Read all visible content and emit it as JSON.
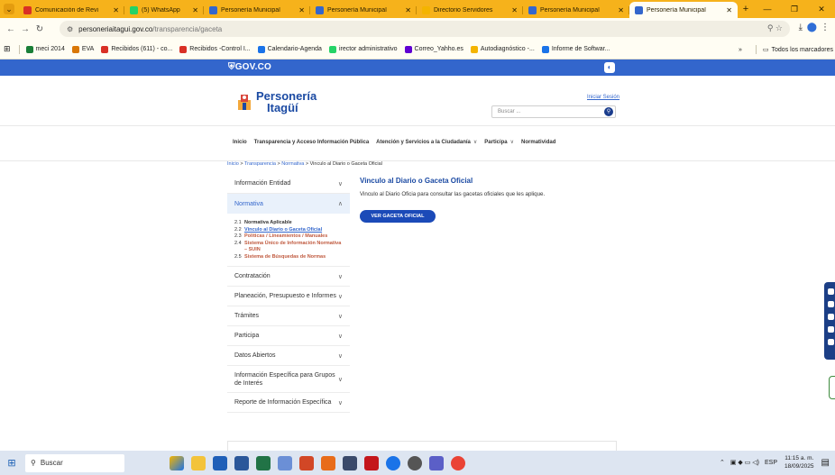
{
  "browser": {
    "tabs": [
      {
        "label": "Comunicación de Revi",
        "color": "#d93025",
        "active": false
      },
      {
        "label": "(5) WhatsApp",
        "color": "#25d366",
        "active": false
      },
      {
        "label": "Personería Municipal",
        "color": "#3366cc",
        "active": false
      },
      {
        "label": "Personería Municipal",
        "color": "#3366cc",
        "active": false
      },
      {
        "label": "Directorio Servidores",
        "color": "#f4b400",
        "active": false
      },
      {
        "label": "Personería Municipal",
        "color": "#3366cc",
        "active": false
      },
      {
        "label": "Personería Municipal",
        "color": "#3366cc",
        "active": true
      }
    ],
    "new_tab": "+",
    "url_domain": "personeriaitagui.gov.co",
    "url_path": "/transparencia/gaceta",
    "bookmarks": [
      {
        "label": "meci 2014",
        "color": "#1a7f37"
      },
      {
        "label": "EVA",
        "color": "#d97706"
      },
      {
        "label": "Recibidos (611) - co...",
        "color": "#d93025"
      },
      {
        "label": "Recibidos -Control I...",
        "color": "#d93025"
      },
      {
        "label": "Calendario-Agenda",
        "color": "#1a73e8"
      },
      {
        "label": "irector administrativo",
        "color": "#25d366"
      },
      {
        "label": "Correo_Yahho.es",
        "color": "#6001d2"
      },
      {
        "label": "Autodiagnóstico -...",
        "color": "#f4b400"
      },
      {
        "label": "Informe de Softwar...",
        "color": "#1a73e8"
      }
    ],
    "bookmarks_more": "»",
    "all_bookmarks": "Todos los marcadores"
  },
  "site": {
    "gov_logo": "GOV.CO",
    "brand_line1": "Personería",
    "brand_line2": "Itagüí",
    "login": "Iniciar Sesión",
    "search_placeholder": "Buscar ...",
    "nav": [
      {
        "label": "Inicio",
        "chevron": false
      },
      {
        "label": "Transparencia y Acceso Información Pública",
        "chevron": false
      },
      {
        "label": "Atención y Servicios a la Ciudadanía",
        "chevron": true
      },
      {
        "label": "Participa",
        "chevron": true
      },
      {
        "label": "Normatividad",
        "chevron": false
      }
    ],
    "breadcrumb": {
      "inicio": "Inicio",
      "transparencia": "Transparencia",
      "normativa": "Normativa",
      "current": "Vinculo al Diario o Gaceta Oficial"
    },
    "sidebar": [
      {
        "label": "Información Entidad",
        "active": false
      },
      {
        "label": "Normativa",
        "active": true
      },
      {
        "label": "Contratación",
        "active": false
      },
      {
        "label": "Planeación, Presupuesto e Informes",
        "active": false
      },
      {
        "label": "Trámites",
        "active": false
      },
      {
        "label": "Participa",
        "active": false
      },
      {
        "label": "Datos Abiertos",
        "active": false
      },
      {
        "label": "Información Específica para Grupos de Interés",
        "active": false
      },
      {
        "label": "Reporte de Información Específica",
        "active": false
      }
    ],
    "normativa_sub": [
      {
        "num": "2.1",
        "label": "Normativa Aplicable",
        "state": "plain"
      },
      {
        "num": "2.2",
        "label": "Vinculo al Diario o Gaceta Oficial",
        "state": "current"
      },
      {
        "num": "2.3",
        "label": "Políticas / Lineamientos / Manuales",
        "state": "link"
      },
      {
        "num": "2.4",
        "label": "Sistema Único de Información Normativa – SUIN",
        "state": "link"
      },
      {
        "num": "2.5",
        "label": "Sistema de Búsquedas de Normas",
        "state": "link"
      }
    ],
    "content": {
      "title": "Vinculo al Diario o Gaceta Oficial",
      "text": "Vinculo al Diario Oficia para consultar las gacetas oficiales que les aplique.",
      "button": "VER GACETA OFICIAL"
    }
  },
  "taskbar": {
    "search": "Buscar",
    "lang": "ESP",
    "time": "11:15 a. m.",
    "date": "18/09/2025"
  }
}
